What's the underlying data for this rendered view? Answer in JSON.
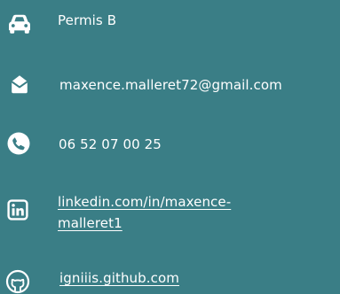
{
  "contacts": {
    "license": "Permis B",
    "email": "maxence.malleret72@gmail.com",
    "phone": "06 52 07 00 25",
    "linkedin_line1": "linkedin.com/in/maxence-",
    "linkedin_line2": "malleret1",
    "github": "igniiis.github.com"
  },
  "icons": [
    "car-icon",
    "envelope-icon",
    "phone-icon",
    "linkedin-icon",
    "github-icon"
  ],
  "colors": {
    "background": "#3a7e86",
    "text": "#ffffff"
  }
}
